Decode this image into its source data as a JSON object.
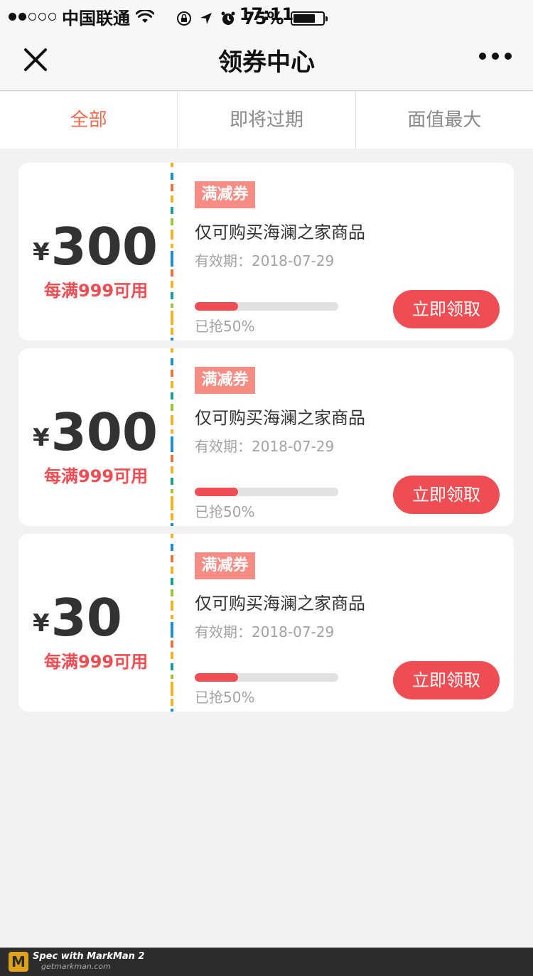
{
  "status_bar": {
    "carrier": "中国联通",
    "time": "17:11",
    "battery": "75%",
    "battery_level": 0.75
  },
  "navbar": {
    "title": "领券中心"
  },
  "tabs": [
    {
      "label": "全部",
      "active": true
    },
    {
      "label": "即将过期",
      "active": false
    },
    {
      "label": "面值最大",
      "active": false
    }
  ],
  "coupons": [
    {
      "currency": "¥",
      "amount": "300",
      "condition": "每满999可用",
      "tag": "满减券",
      "description": "仅可购买海澜之家商品",
      "expiry": "有效期：2018-07-29",
      "progress": 0.3,
      "grabbed": "已抢50%",
      "button": "立即领取"
    },
    {
      "currency": "¥",
      "amount": "300",
      "condition": "每满999可用",
      "tag": "满减券",
      "description": "仅可购买海澜之家商品",
      "expiry": "有效期：2018-07-29",
      "progress": 0.3,
      "grabbed": "已抢50%",
      "button": "立即领取"
    },
    {
      "currency": "¥",
      "amount": "30",
      "condition": "每满999可用",
      "tag": "满减券",
      "description": "仅可购买海澜之家商品",
      "expiry": "有效期：2018-07-29",
      "progress": 0.3,
      "grabbed": "已抢50%",
      "button": "立即领取"
    }
  ],
  "footer": {
    "logo": "M",
    "brand": "Spec with MarkMan 2",
    "site": "getmarkman.com"
  },
  "colors": {
    "accent_red": "#ee4e53",
    "tab_active": "#f26b4f",
    "tag_bg": "#f68c84",
    "text_dark": "#323232",
    "text_gray": "#a3a3a3"
  }
}
